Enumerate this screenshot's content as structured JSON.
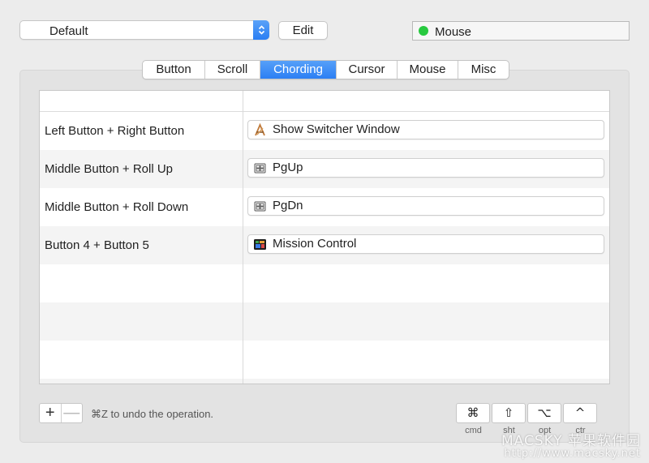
{
  "preset": {
    "selected": "Default"
  },
  "edit_label": "Edit",
  "device": {
    "name": "Mouse",
    "status_color": "#27c93f"
  },
  "tabs": [
    {
      "label": "Button"
    },
    {
      "label": "Scroll"
    },
    {
      "label": "Chording"
    },
    {
      "label": "Cursor"
    },
    {
      "label": "Mouse"
    },
    {
      "label": "Misc"
    }
  ],
  "active_tab": "Chording",
  "chords": [
    {
      "trigger": "Left Button + Right Button",
      "action": "Show Switcher Window",
      "icon": "app-store-icon"
    },
    {
      "trigger": "Middle Button + Roll Up",
      "action": "PgUp",
      "icon": "keyboard-icon"
    },
    {
      "trigger": "Middle Button + Roll Down",
      "action": "PgDn",
      "icon": "keyboard-icon"
    },
    {
      "trigger": "Button 4 + Button 5",
      "action": "Mission Control",
      "icon": "mission-control-icon"
    }
  ],
  "bottom": {
    "plus": "+",
    "minus": "—",
    "undo_hint": "⌘Z to undo the operation."
  },
  "modifiers": [
    {
      "symbol": "⌘",
      "label": "cmd"
    },
    {
      "symbol": "⇧",
      "label": "sht"
    },
    {
      "symbol": "⌥",
      "label": "opt"
    },
    {
      "symbol": "^",
      "label": "ctr"
    }
  ],
  "watermark": {
    "main": "MACSKY 苹果软件园",
    "url": "http://www.macsky.net"
  },
  "colors": {
    "accent": "#2c7ff4",
    "row_alt": "#f4f4f4"
  }
}
